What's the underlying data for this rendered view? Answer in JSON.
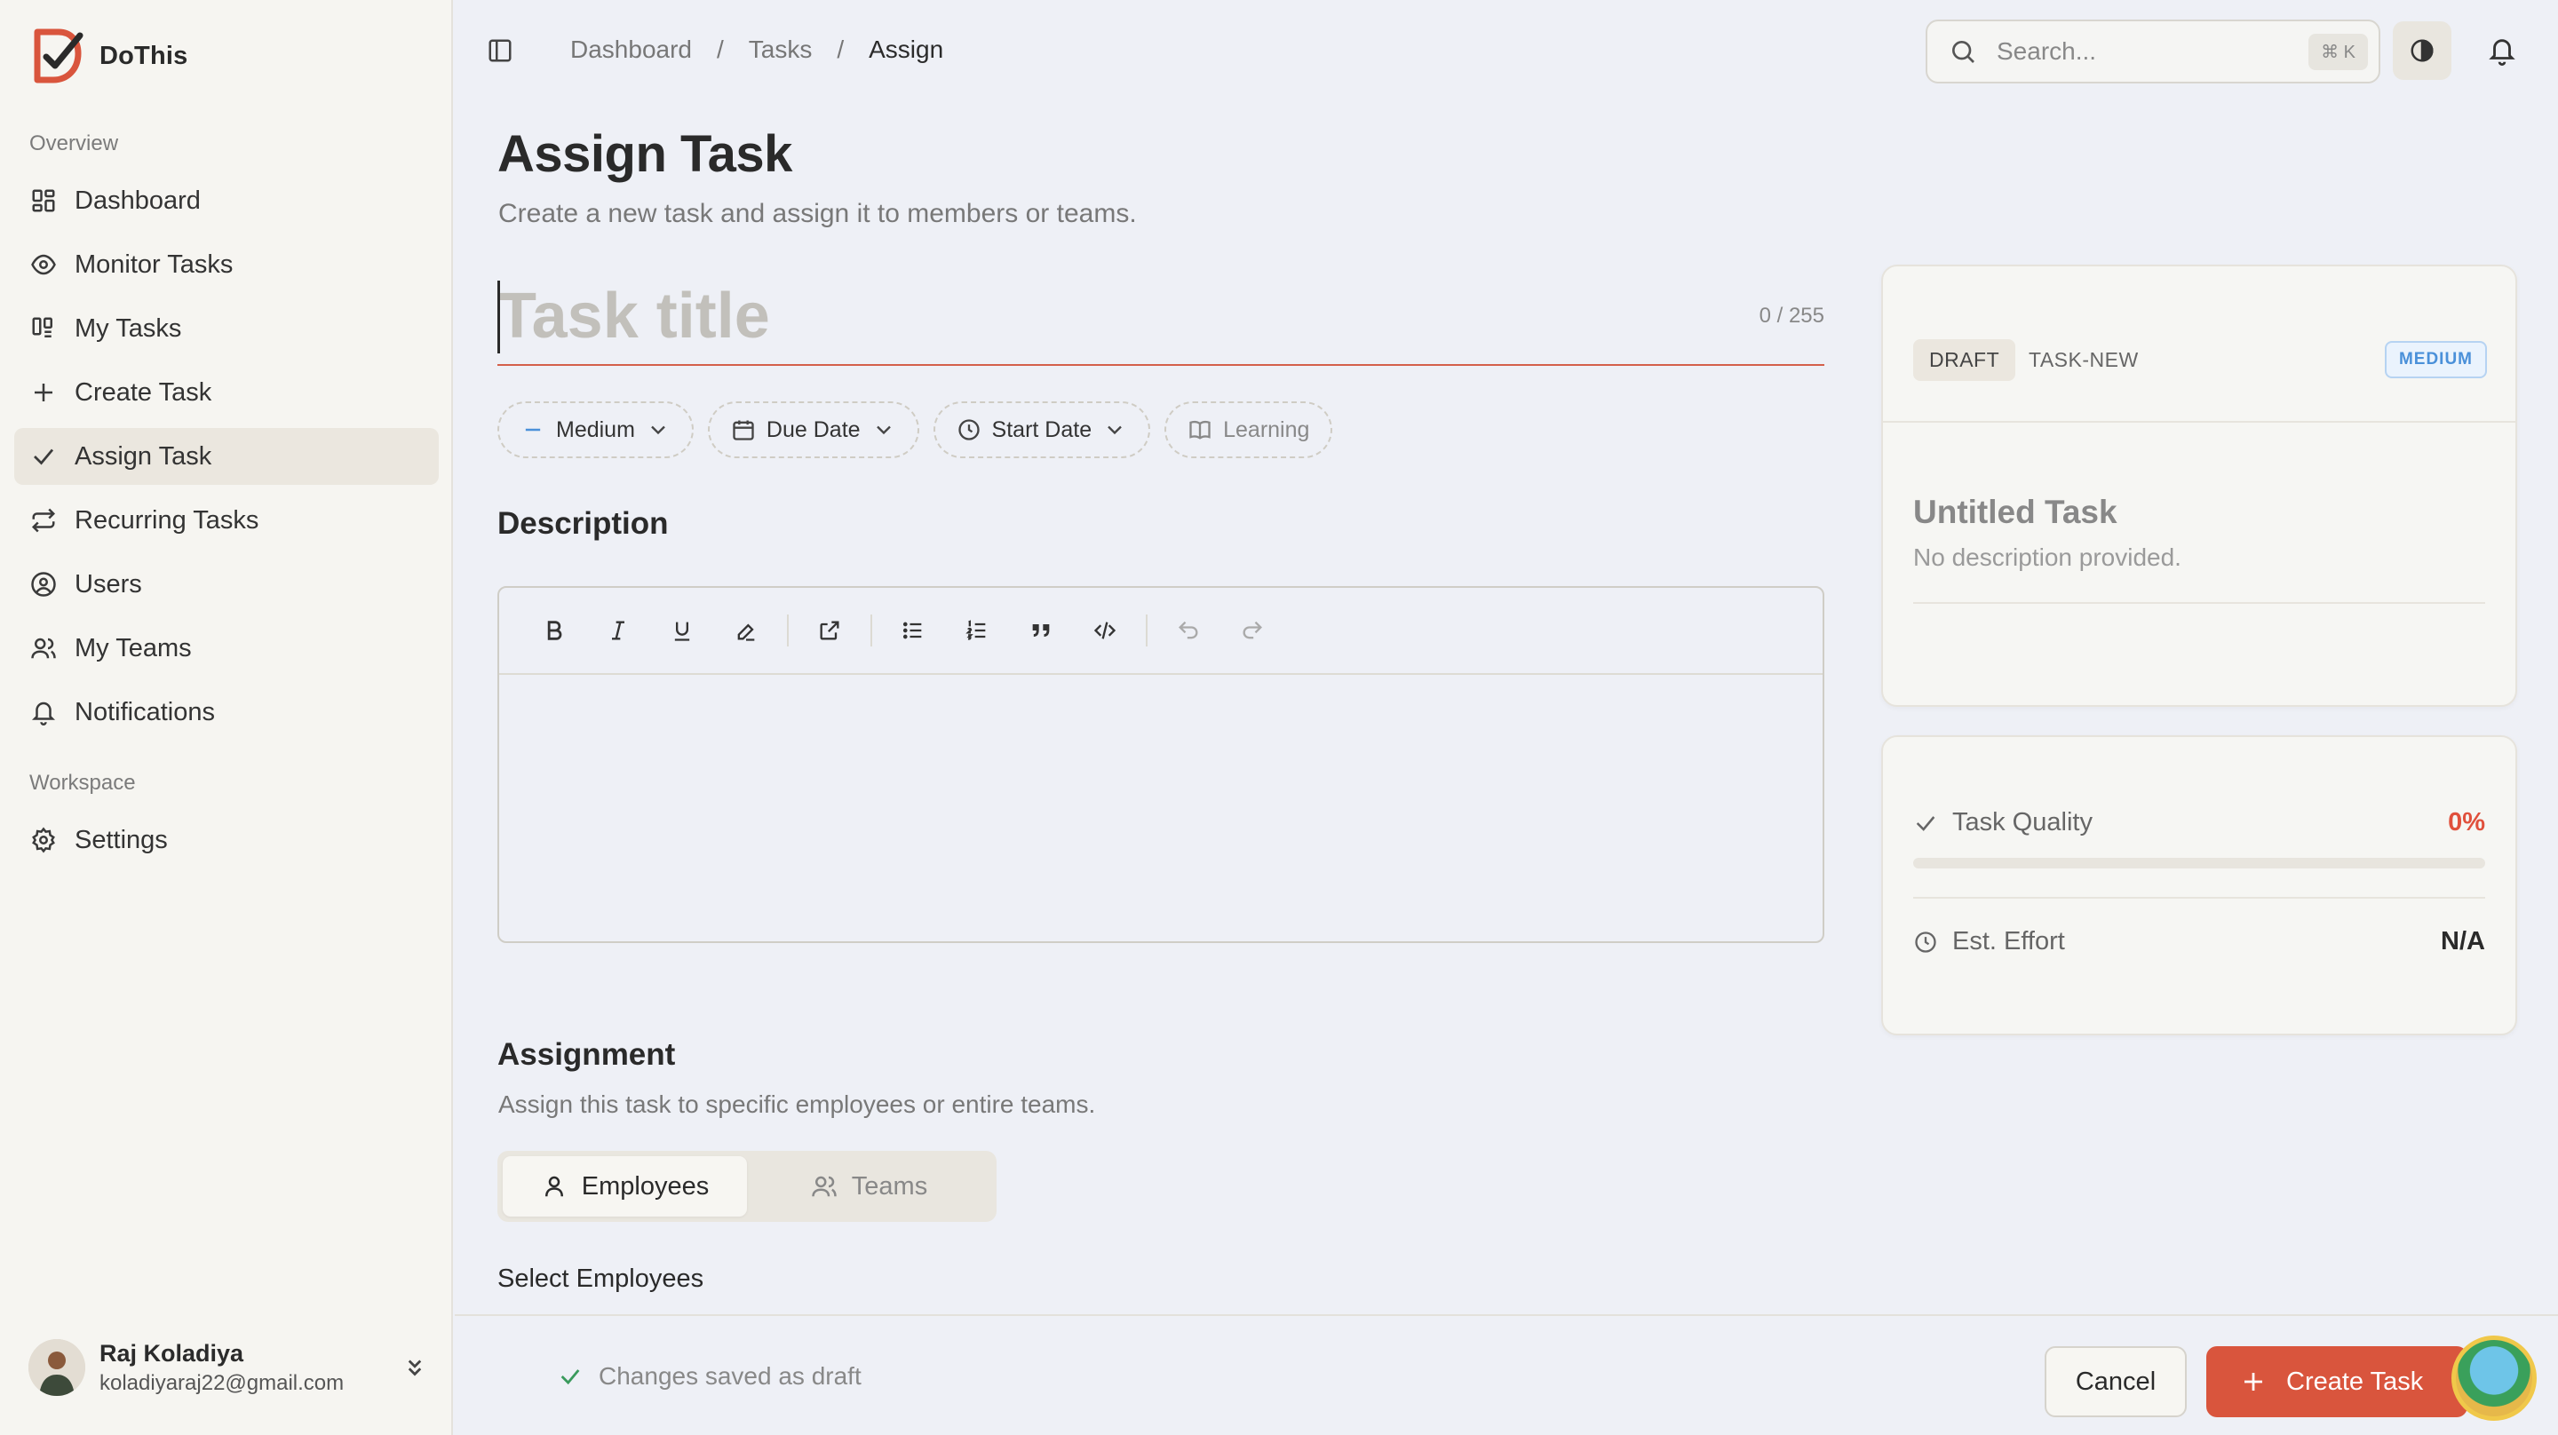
{
  "app": {
    "name": "DoThis"
  },
  "sidebar": {
    "sections": [
      {
        "label": "Overview",
        "items": [
          {
            "label": "Dashboard",
            "icon": "dashboard-icon"
          },
          {
            "label": "Monitor Tasks",
            "icon": "eye-icon"
          },
          {
            "label": "My Tasks",
            "icon": "kanban-icon"
          },
          {
            "label": "Create Task",
            "icon": "plus-icon"
          },
          {
            "label": "Assign Task",
            "icon": "check-icon",
            "active": true
          },
          {
            "label": "Recurring Tasks",
            "icon": "repeat-icon"
          },
          {
            "label": "Users",
            "icon": "user-circle-icon"
          },
          {
            "label": "My Teams",
            "icon": "users-icon"
          },
          {
            "label": "Notifications",
            "icon": "bell-icon"
          }
        ]
      },
      {
        "label": "Workspace",
        "items": [
          {
            "label": "Settings",
            "icon": "gear-icon"
          }
        ]
      }
    ],
    "user": {
      "name": "Raj Koladiya",
      "email": "koladiyaraj22@gmail.com"
    }
  },
  "topbar": {
    "breadcrumb": [
      "Dashboard",
      "Tasks",
      "Assign"
    ],
    "search": {
      "placeholder": "Search...",
      "shortcut": "⌘ K"
    }
  },
  "main": {
    "title": "Assign Task",
    "subtitle": "Create a new task and assign it to members or teams.",
    "task_title": {
      "placeholder": "Task title",
      "value": "",
      "counter": "0 / 255"
    },
    "chips": [
      {
        "label": "Medium",
        "icon": "dash-icon",
        "dropdown": true
      },
      {
        "label": "Due Date",
        "icon": "calendar-icon",
        "dropdown": true
      },
      {
        "label": "Start Date",
        "icon": "clock-icon",
        "dropdown": true
      },
      {
        "label": "Learning",
        "icon": "book-icon",
        "dropdown": false
      }
    ],
    "description": {
      "heading": "Description"
    },
    "editor_toolbar": [
      "bold-icon",
      "italic-icon",
      "underline-icon",
      "highlight-icon",
      "link-icon",
      "bullet-list-icon",
      "numbered-list-icon",
      "quote-icon",
      "code-icon",
      "undo-icon",
      "redo-icon"
    ],
    "assignment": {
      "heading": "Assignment",
      "subtitle": "Assign this task to specific employees or entire teams.",
      "tabs": [
        {
          "label": "Employees",
          "active": true
        },
        {
          "label": "Teams",
          "active": false
        }
      ],
      "select_label": "Select Employees"
    }
  },
  "preview": {
    "status": "DRAFT",
    "task_id": "TASK-NEW",
    "priority": "MEDIUM",
    "title": "Untitled Task",
    "description": "No description provided."
  },
  "metrics": {
    "quality": {
      "label": "Task Quality",
      "value": "0%",
      "progress": 0
    },
    "effort": {
      "label": "Est. Effort",
      "value": "N/A"
    }
  },
  "footer": {
    "status": "Changes saved as draft",
    "cancel_label": "Cancel",
    "create_label": "Create Task"
  },
  "colors": {
    "accent": "#d9553d",
    "background": "#eef0f6",
    "sidebar": "#f6f5f1",
    "priority_blue": "#4a90d9",
    "success_green": "#3a9a5c"
  }
}
